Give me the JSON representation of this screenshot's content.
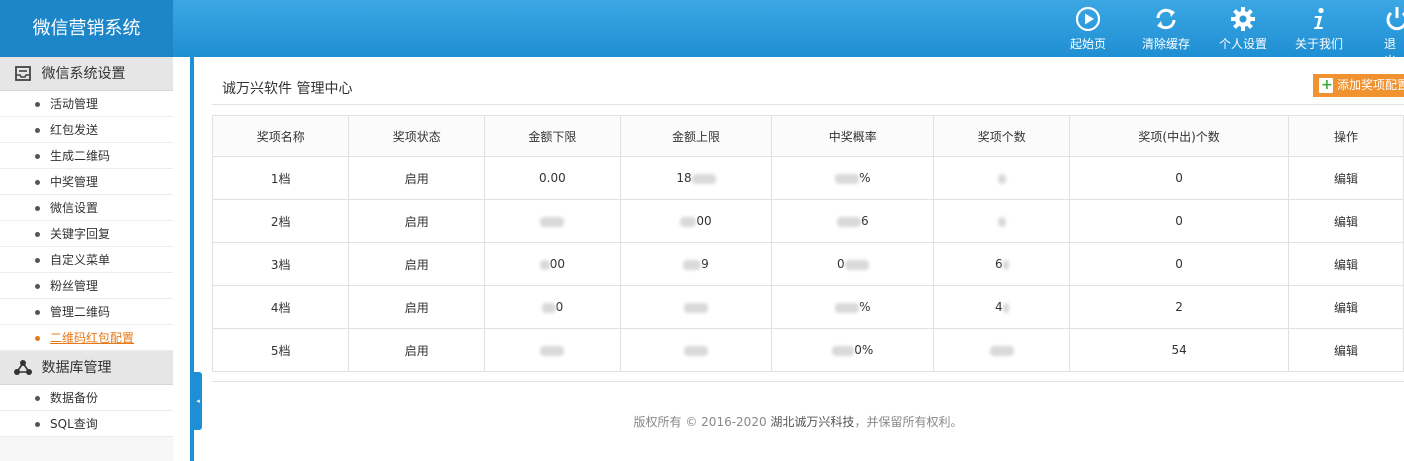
{
  "app": {
    "title": "微信营销系统"
  },
  "topnav": [
    {
      "label": "起始页",
      "icon": "play-icon"
    },
    {
      "label": "清除缓存",
      "icon": "refresh-icon"
    },
    {
      "label": "个人设置",
      "icon": "gear-icon"
    },
    {
      "label": "关于我们",
      "icon": "info-icon"
    },
    {
      "label": "退出",
      "icon": "power-icon"
    }
  ],
  "sidebar": {
    "groups": [
      {
        "title": "微信系统设置",
        "icon": "inbox-icon",
        "items": [
          "活动管理",
          "红包发送",
          "生成二维码",
          "中奖管理",
          "微信设置",
          "关键字回复",
          "自定义菜单",
          "粉丝管理",
          "管理二维码",
          "二维码红包配置"
        ]
      },
      {
        "title": "数据库管理",
        "icon": "network-icon",
        "items": [
          "数据备份",
          "SQL查询"
        ]
      }
    ],
    "active": "二维码红包配置"
  },
  "page": {
    "title": "诚万兴软件 管理中心",
    "add_button": "添加奖项配置"
  },
  "table": {
    "columns": [
      "奖项名称",
      "奖项状态",
      "金额下限",
      "金额上限",
      "中奖概率",
      "奖项个数",
      "奖项(中出)个数",
      "操作"
    ],
    "rows": [
      {
        "name": "1档",
        "status": "启用",
        "min": "0.00",
        "max": "18",
        "rate": "%",
        "count": "",
        "won": "0",
        "action": "编辑"
      },
      {
        "name": "2档",
        "status": "启用",
        "min": "",
        "max": "00",
        "rate": "6",
        "count": "",
        "won": "0",
        "action": "编辑"
      },
      {
        "name": "3档",
        "status": "启用",
        "min": "00",
        "max": "9",
        "rate": "0",
        "count": "6",
        "won": "0",
        "action": "编辑"
      },
      {
        "name": "4档",
        "status": "启用",
        "min": "0",
        "max": "",
        "rate": "%",
        "count": "4",
        "won": "2",
        "action": "编辑"
      },
      {
        "name": "5档",
        "status": "启用",
        "min": "",
        "max": "",
        "rate": "0%",
        "count": "",
        "won": "54",
        "action": "编辑"
      }
    ]
  },
  "footer": {
    "prefix": "版权所有 © 2016-2020",
    "company": "湖北诚万兴科技",
    "suffix": "，并保留所有权利。"
  },
  "colors": {
    "brand": "#1d86c9",
    "accent": "#f0922f",
    "active": "#e77817"
  }
}
